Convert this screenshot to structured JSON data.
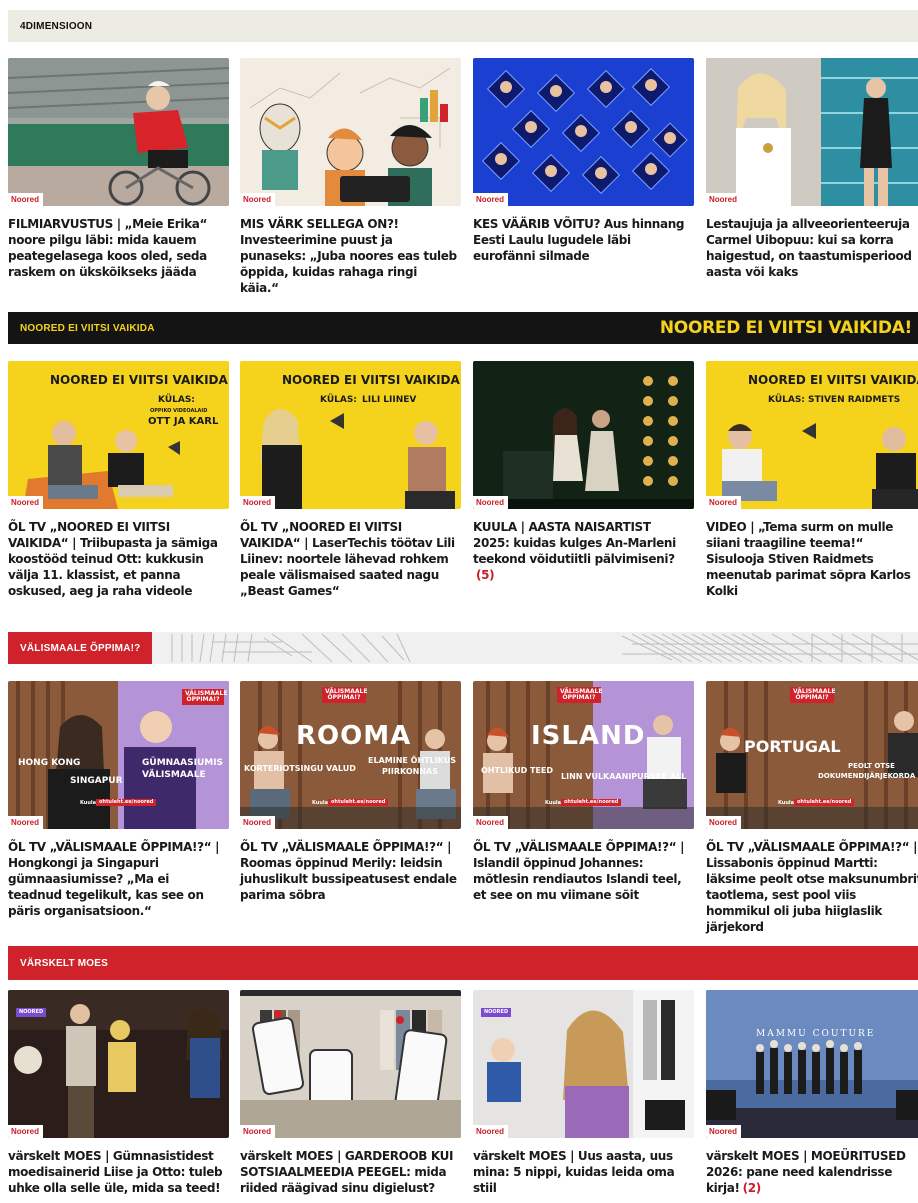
{
  "sections": {
    "dimensioon": {
      "label": "4DIMENSIOON"
    },
    "noored": {
      "label": "NOORED EI VIITSI VAIKIDA",
      "logo_text": "NOORED EI VIITSI VAIKIDA!"
    },
    "valismaale": {
      "label": "VÄLISMAALE ÕPPIMA!?"
    },
    "moes": {
      "label": "VÄRSKELT MOES"
    }
  },
  "tag_label": "Noored",
  "rows": [
    {
      "cards": [
        {
          "headline": "FILMIARVUSTUS | „Meie Erika“ noore pilgu läbi: mida kauem peategelasega koos oled, seda raskem on ükskõikseks jääda",
          "comments": ""
        },
        {
          "headline": "MIS VÄRK SELLEGA ON?! Investeerimine puust ja punaseks: „Juba noores eas tuleb õppida, kuidas rahaga ringi käia.“",
          "comments": ""
        },
        {
          "headline": "KES VÄÄRIB VÕITU? Aus hinnang Eesti Laulu lugudele läbi eurofänni silmade",
          "comments": ""
        },
        {
          "headline": "Lestaujuja ja allveeorienteeruja Carmel Uibopuu: kui sa korra haigestud, on taastumisperiood aasta või kaks",
          "comments": ""
        }
      ]
    },
    {
      "cards": [
        {
          "headline": "ÕL TV „NOORED EI VIITSI VAIKIDA“ | Triibupasta ja sämiga koostööd teinud Ott: kukkusin välja 11. klassist, et panna oskused, aeg ja raha videole",
          "comments": "",
          "thumb": {
            "title": "NOORED EI VIITSI VAIKIDA!",
            "guest_label": "KÜLAS:",
            "guest_sub": "OPPIKO VIDEOALAID",
            "guest": "OTT JA KARL"
          }
        },
        {
          "headline": "ÕL TV „NOORED EI VIITSI VAIKIDA“ | LaserTechis töötav Lili Liinev: noortele lähevad rohkem peale välismaised saated nagu „Beast Games“",
          "comments": "",
          "thumb": {
            "title": "NOORED EI VIITSI VAIKIDA!",
            "guest_label": "KÜLAS:",
            "guest": "LILI LIINEV"
          }
        },
        {
          "headline": "KUULA | AASTA NAISARTIST 2025: kuidas kulges An-Marleni teekond võidutiitli pälvimiseni?",
          "comments": "(5)"
        },
        {
          "headline": "VIDEO | „Tema surm on mulle siiani traagiline teema!“ Sisulooja Stiven Raidmets meenutab parimat sõpra Karlos Kolki",
          "comments": "",
          "thumb": {
            "title": "NOORED EI VIITSI VAIKIDA!",
            "guest_label": "KÜLAS:",
            "guest": "STIVEN RAIDMETS"
          }
        }
      ]
    },
    {
      "cards": [
        {
          "headline": "ÕL TV „VÄLISMAALE ÕPPIMA!?“ | Hongkongi ja Singapuri gümnaasiumisse? „Ma ei teadnud tegelikult, kas see on päris organisatsioon.“",
          "comments": "",
          "thumb": {
            "badge": "VÄLISMAALE ÕPPIMA!?",
            "big": "",
            "left": "HONG KONG",
            "left2": "SINGAPUR",
            "right": "GÜMNAASIUMIS",
            "right2": "VÄLISMAALE",
            "listen": "Kuula:",
            "url": "ohtuleht.ee/noored"
          }
        },
        {
          "headline": "ÕL TV „VÄLISMAALE ÕPPIMA!?“ | Roomas õppinud Merily: leidsin juhuslikult bussipeatusest endale parima sõbra",
          "comments": "",
          "thumb": {
            "badge": "VÄLISMAALE ÕPPIMA!?",
            "big": "ROOMA",
            "left": "KORTERIOTSINGU VALUD",
            "right": "ELAMINE ÕHTLIKUS",
            "right2": "PIIRKONNAS",
            "listen": "Kuula:",
            "url": "ohtuleht.ee/noored"
          }
        },
        {
          "headline": "ÕL TV „VÄLISMAALE ÕPPIMA!?“ | Islandil õppinud Johannes: mõtlesin rendiautos Islandi teel, et see on mu viimane sõit",
          "comments": "",
          "thumb": {
            "badge": "VÄLISMAALE ÕPPIMA!?",
            "big": "ISLAND",
            "left": "OHTLIKUD TEED",
            "right": "LINN VULKAANIPURSKE ALL",
            "listen": "Kuula:",
            "url": "ohtuleht.ee/noored"
          }
        },
        {
          "headline": "ÕL TV „VÄLISMAALE ÕPPIMA!?“ | Lissabonis õppinud Martti: läksime peolt otse maksunumbrit taotlema, sest pool viis hommikul oli juba hiiglaslik järjekord",
          "comments": "",
          "thumb": {
            "badge": "VÄLISMAALE ÕPPIMA!?",
            "big": "PORTUGAL",
            "right": "PEOLT OTSE",
            "right2": "DOKUMENDIJÄRJEKORDA",
            "listen": "Kuula:",
            "url": "ohtuleht.ee/noored"
          }
        }
      ]
    },
    {
      "cards": [
        {
          "headline": "värskelt MOES | Gümnasistidest moedisainerid Liise ja Otto: tuleb uhke olla selle üle, mida sa teed!",
          "comments": "",
          "thumb": {
            "badge": "NOORED"
          }
        },
        {
          "headline": "värskelt MOES | GARDEROOB KUI SOTSIAALMEEDIA PEEGEL: mida riided räägivad sinu digielust?",
          "comments": ""
        },
        {
          "headline": "värskelt MOES | Uus aasta, uus mina: 5 nippi, kuidas leida oma stiil",
          "comments": "",
          "thumb": {
            "badge": "NOORED"
          }
        },
        {
          "headline": "värskelt MOES | MOEÜRITUSED 2026: pane need kalendrisse kirja!",
          "comments": "(2)",
          "thumb": {
            "brand": "MAMMU COUTURE"
          }
        }
      ]
    }
  ],
  "colors": {
    "accent_red": "#d0222b",
    "noored_yellow": "#f5d31d",
    "bar_beige": "#ecece2",
    "bar_black": "#141414"
  }
}
